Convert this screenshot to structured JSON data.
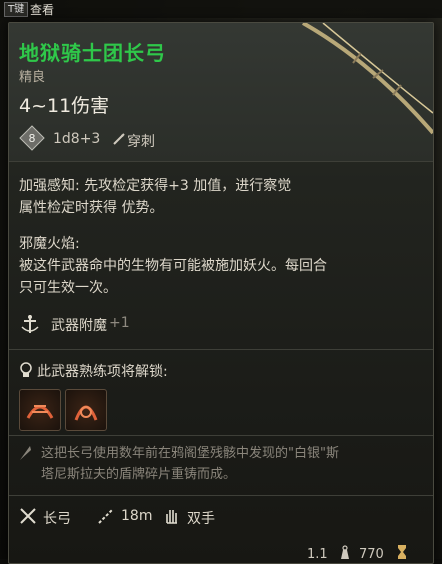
{
  "topbar": {
    "key_hint": "T键",
    "view_label": "查看"
  },
  "item": {
    "name": "地狱骑士团长弓",
    "rarity": "精良",
    "damage": "4~11伤害",
    "dice_value": "8",
    "dice_formula": "1d8+3",
    "damage_type": "穿刺"
  },
  "properties": [
    {
      "title": "加强感知: 先攻检定获得+3 加值，进行察觉",
      "title2": "属性检定时获得 优势。"
    },
    {
      "title": "邪魔火焰:",
      "line1": "被这件武器命中的生物有可能被施加妖火。每回合",
      "line2": "只可生效一次。"
    }
  ],
  "enchantment": {
    "label": "武器附魔",
    "bonus": "+1"
  },
  "proficiency": {
    "label": "此武器熟练项将解锁:"
  },
  "lore": {
    "line1": "这把长弓使用数年前在鸦阁堡残骸中发现的\"白银\"斯",
    "line2": "塔尼斯拉夫的盾牌碎片重铸而成。"
  },
  "tags": {
    "weapon_type": "长弓",
    "range": "18m",
    "handedness": "双手"
  },
  "footer": {
    "weight": "1.1",
    "value": "770"
  },
  "colors": {
    "name": "#2fc84a",
    "background": "#22241f"
  }
}
